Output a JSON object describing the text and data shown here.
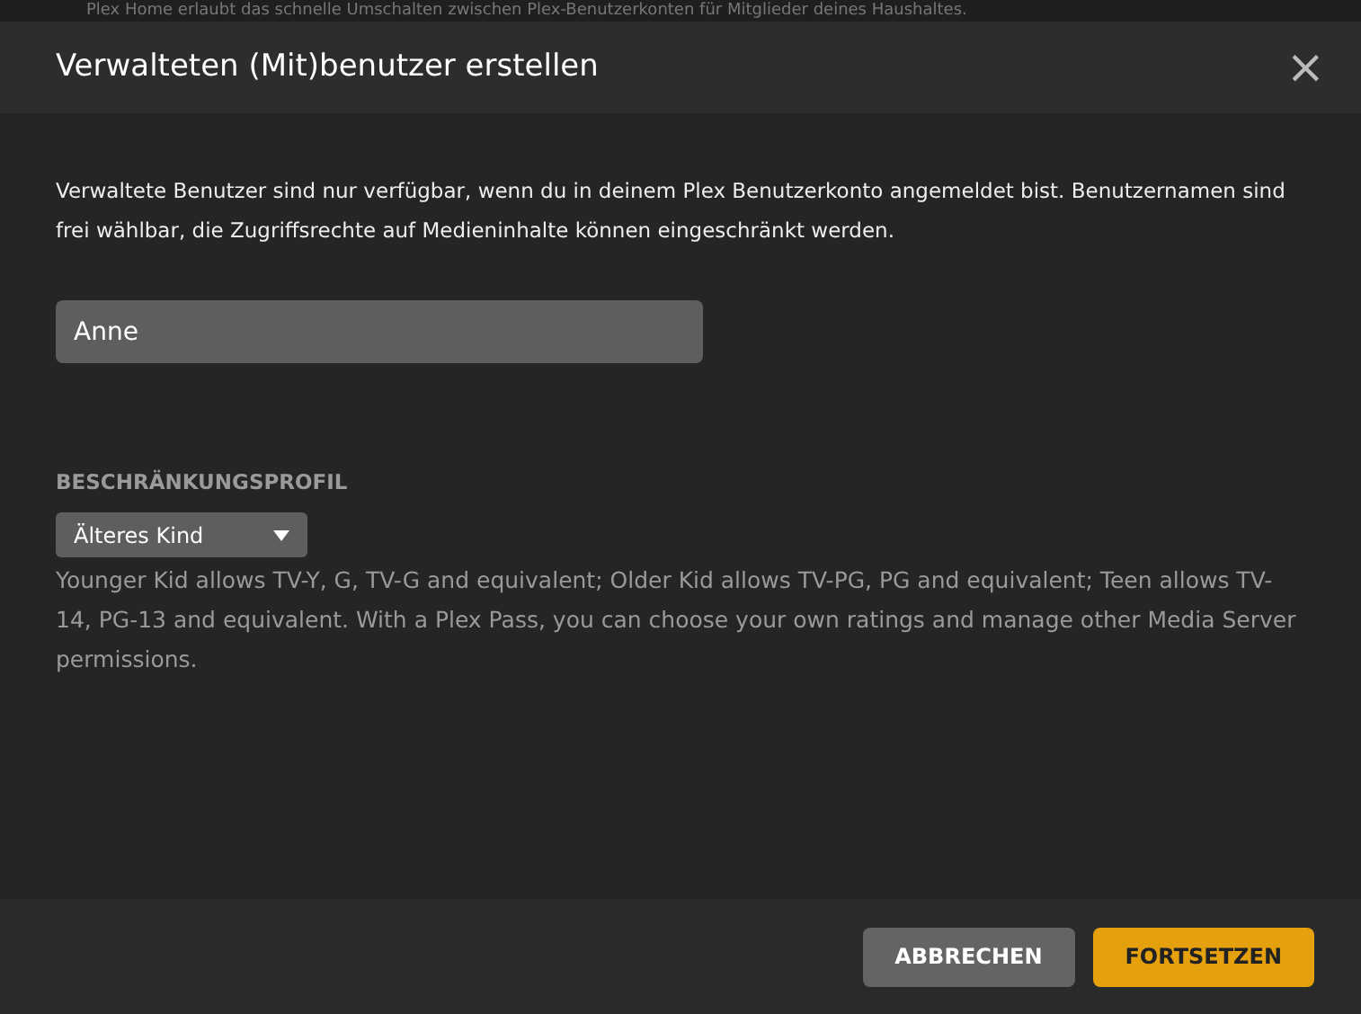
{
  "background_text": "Plex Home erlaubt das schnelle Umschalten zwischen Plex-Benutzerkonten für Mitglieder deines Haushaltes.",
  "dialog": {
    "title": "Verwalteten (Mit)benutzer erstellen",
    "close": "×",
    "intro": "Verwaltete Benutzer sind nur verfügbar, wenn du in deinem Plex Benutzerkonto angemeldet bist. Benutzernamen sind frei wählbar, die Zugriffsrechte auf Medieninhalte können eingeschränkt werden.",
    "name_field": {
      "value": "Anne"
    },
    "restriction": {
      "label": "BESCHRÄNKUNGSPROFIL",
      "value": "Älteres Kind",
      "help": "Younger Kid allows TV-Y, G, TV-G and equivalent; Older Kid allows TV-PG, PG and equivalent; Teen allows TV-14, PG-13 and equivalent. With a Plex Pass, you can choose your own ratings and manage other Media Server permissions."
    },
    "buttons": [
      {
        "label": "ABBRECHEN",
        "kind": "secondary"
      },
      {
        "label": "FORTSETZEN",
        "kind": "primary"
      }
    ]
  }
}
